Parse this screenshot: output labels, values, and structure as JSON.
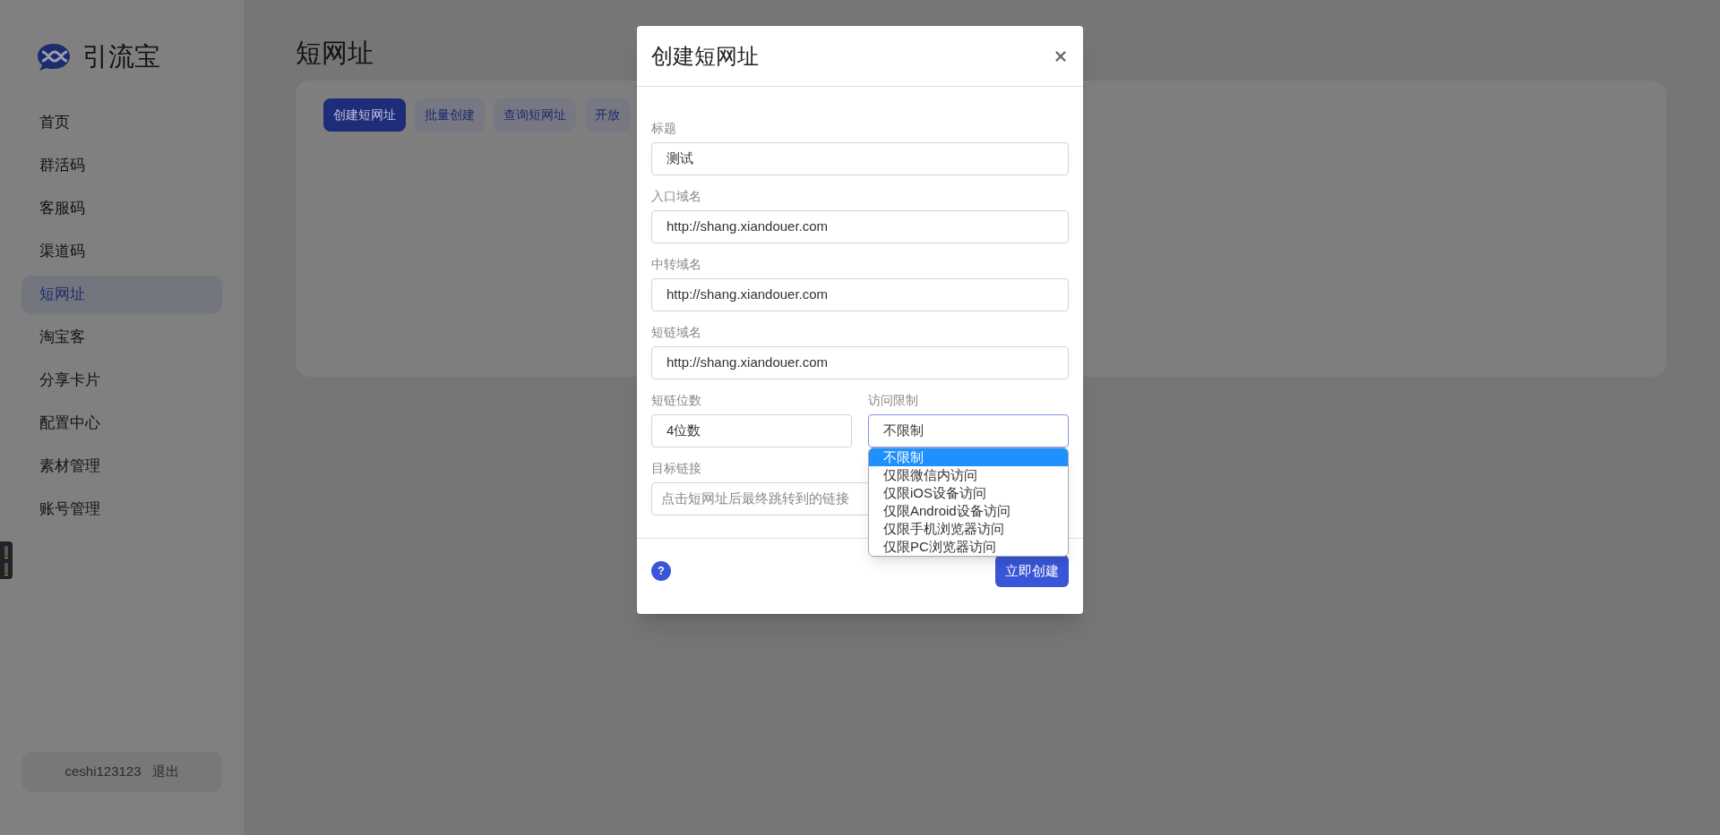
{
  "sidebar": {
    "brand": "引流宝",
    "items": [
      {
        "label": "首页",
        "selected": false
      },
      {
        "label": "群活码",
        "selected": false
      },
      {
        "label": "客服码",
        "selected": false
      },
      {
        "label": "渠道码",
        "selected": false
      },
      {
        "label": "短网址",
        "selected": true
      },
      {
        "label": "淘宝客",
        "selected": false
      },
      {
        "label": "分享卡片",
        "selected": false
      },
      {
        "label": "配置中心",
        "selected": false
      },
      {
        "label": "素材管理",
        "selected": false
      },
      {
        "label": "账号管理",
        "selected": false
      }
    ],
    "user": "ceshi123123",
    "logout": "退出"
  },
  "page": {
    "title": "短网址",
    "tabs": [
      {
        "label": "创建短网址",
        "selected": true
      },
      {
        "label": "批量创建",
        "selected": false
      },
      {
        "label": "查询短网址",
        "selected": false
      },
      {
        "label": "开放",
        "selected": false
      }
    ]
  },
  "modal": {
    "title": "创建短网址",
    "rows": [
      [
        {
          "kind": "input",
          "label": "标题",
          "value": "测试"
        }
      ],
      [
        {
          "kind": "input",
          "label": "入口域名",
          "value": "http://shang.xiandouer.com"
        }
      ],
      [
        {
          "kind": "input",
          "label": "中转域名",
          "value": "http://shang.xiandouer.com"
        }
      ],
      [
        {
          "kind": "input",
          "label": "短链域名",
          "value": "http://shang.xiandouer.com"
        }
      ],
      [
        {
          "kind": "select",
          "label": "短链位数",
          "value": "4位数",
          "open": false
        },
        {
          "kind": "select",
          "label": "访问限制",
          "value": "不限制",
          "open": true,
          "options": [
            {
              "label": "不限制",
              "selected": true
            },
            {
              "label": "仅限微信内访问",
              "selected": false
            },
            {
              "label": "仅限iOS设备访问",
              "selected": false
            },
            {
              "label": "仅限Android设备访问",
              "selected": false
            },
            {
              "label": "仅限手机浏览器访问",
              "selected": false
            },
            {
              "label": "仅限PC浏览器访问",
              "selected": false
            }
          ]
        }
      ],
      [
        {
          "kind": "input",
          "label": "目标链接",
          "placeholder": "点击短网址后最终跳转到的链接"
        }
      ]
    ],
    "help": "?",
    "submit": "立即创建"
  }
}
